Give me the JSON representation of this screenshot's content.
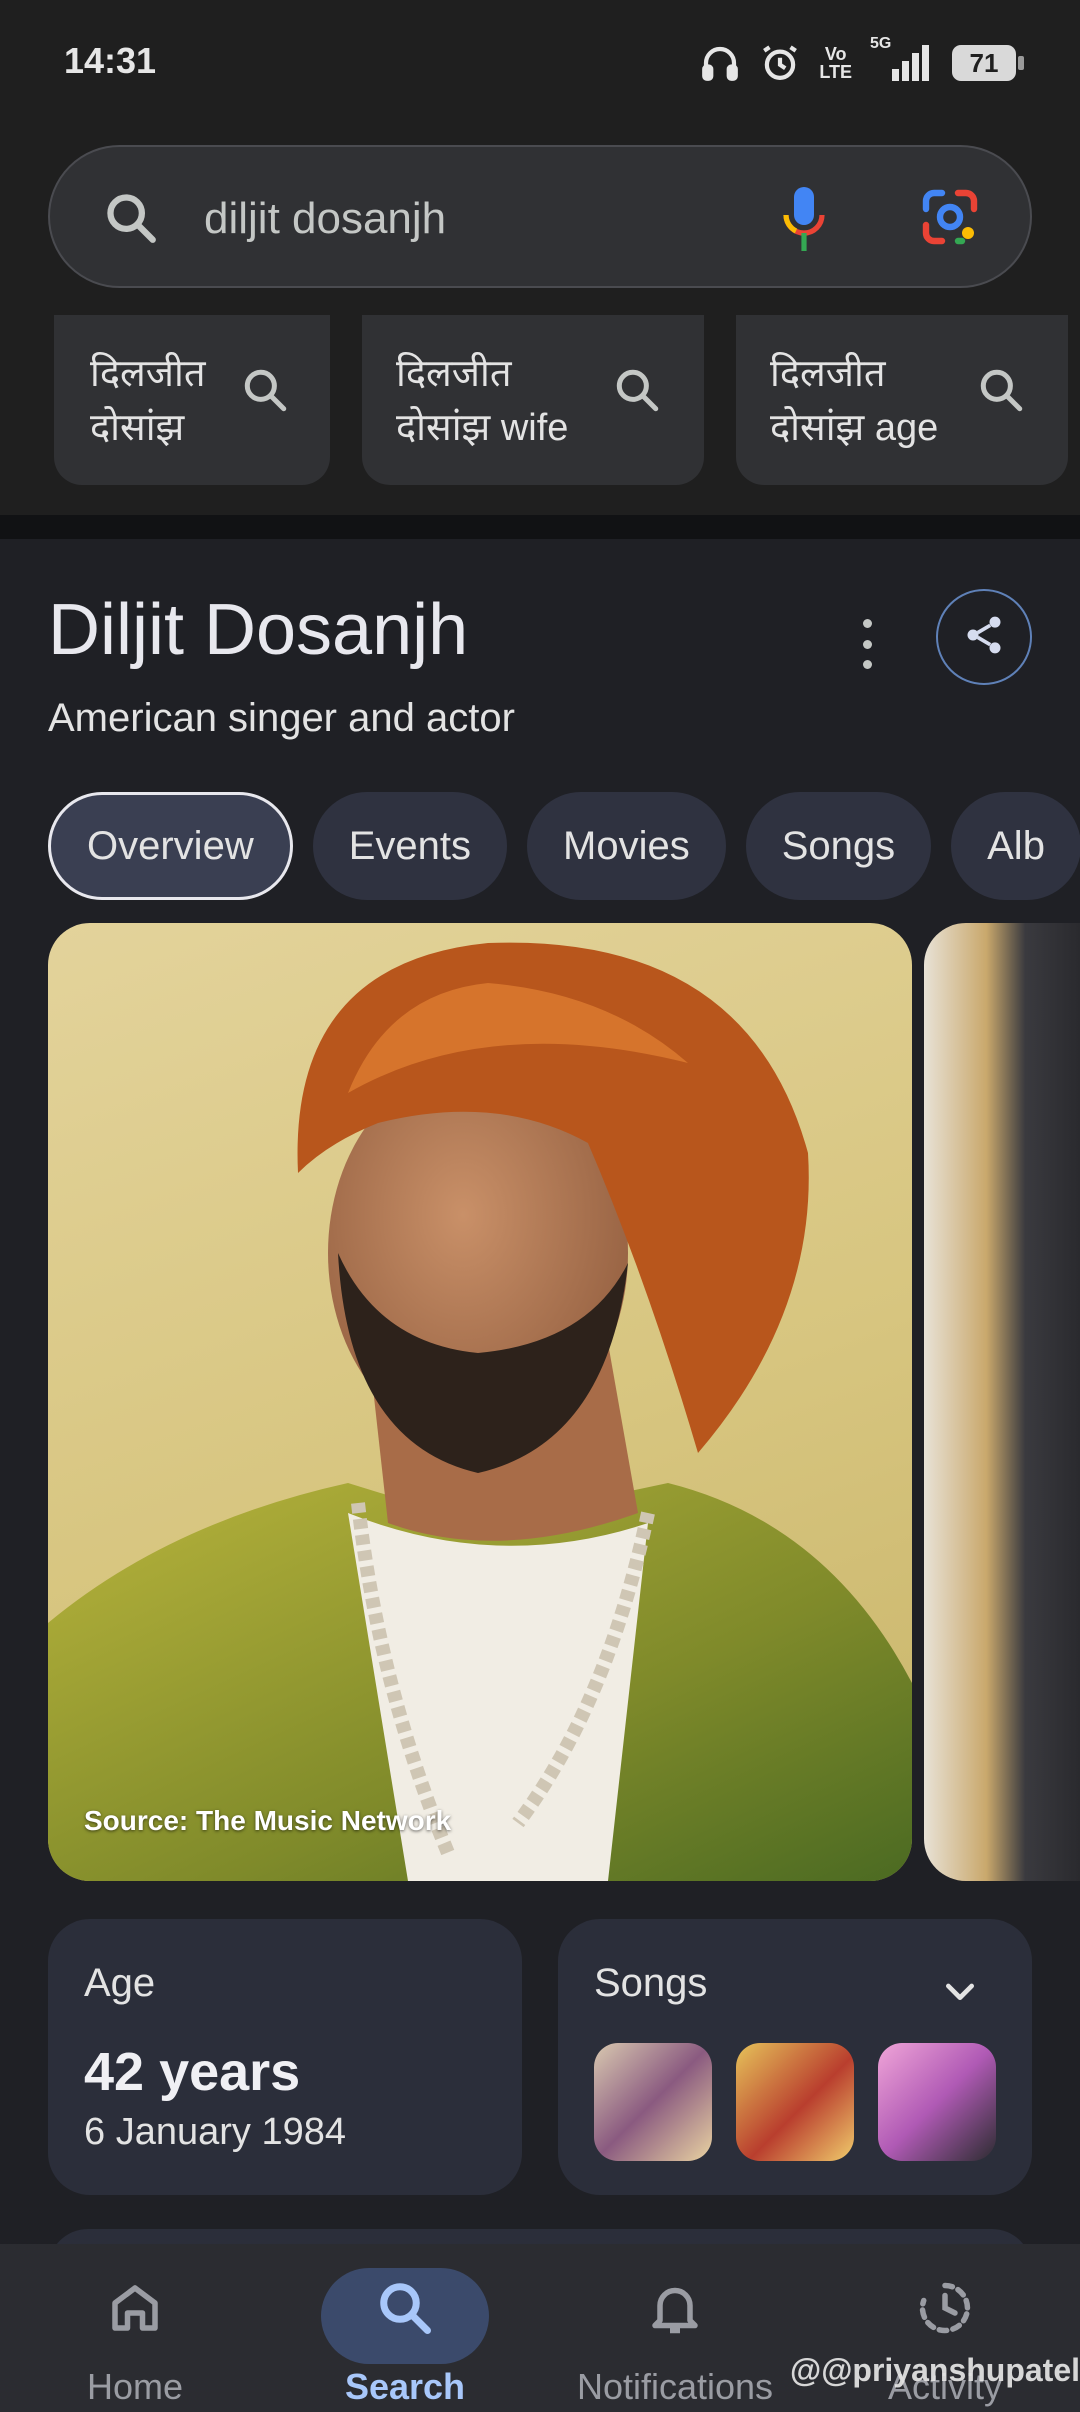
{
  "status_bar": {
    "time": "14:31",
    "icons": [
      "headphones-icon",
      "alarm-icon",
      "volte-icon",
      "5g-signal-icon",
      "battery-icon"
    ],
    "volte_top": "Vo",
    "volte_bottom": "LTE",
    "network": "5G",
    "battery": "71"
  },
  "search": {
    "query": "diljit dosanjh",
    "icons": [
      "search-icon",
      "mic-icon",
      "lens-icon"
    ]
  },
  "suggestions": [
    {
      "line1": "दिलजीत",
      "line2": "दोसांझ"
    },
    {
      "line1": "दिलजीत",
      "line2": "दोसांझ wife"
    },
    {
      "line1": "दिलजीत",
      "line2": "दोसांझ age"
    }
  ],
  "knowledge_panel": {
    "title": "Diljit Dosanjh",
    "subtitle": "American singer and actor",
    "tabs": [
      "Overview",
      "Events",
      "Movies",
      "Songs",
      "Alb"
    ],
    "active_tab": "Overview",
    "photo_source": "Source: The Music Network",
    "age_card": {
      "label": "Age",
      "value": "42 years",
      "date": "6 January 1984"
    },
    "songs_card": {
      "label": "Songs"
    }
  },
  "bottom_nav": {
    "items": [
      {
        "label": "Home",
        "icon": "home-icon"
      },
      {
        "label": "Search",
        "icon": "search-icon"
      },
      {
        "label": "Notifications",
        "icon": "bell-icon"
      },
      {
        "label": "Activity",
        "icon": "history-icon"
      }
    ],
    "active": "Search"
  },
  "watermark": "@@priyanshupatel",
  "colors": {
    "background": "#1f2025",
    "accent": "#a8c7fa",
    "card": "#2b2e3a"
  }
}
